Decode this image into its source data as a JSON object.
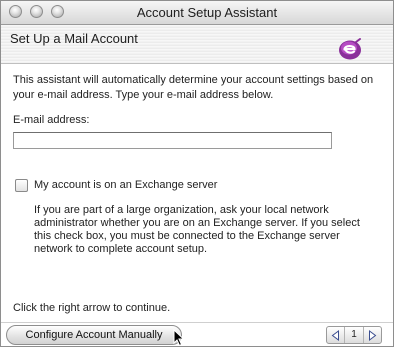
{
  "window": {
    "title": "Account Setup Assistant"
  },
  "header": {
    "title": "Set Up a Mail Account"
  },
  "main": {
    "intro": "This assistant will automatically determine your account settings based on your e-mail address. Type your e-mail address below.",
    "email_label": "E-mail address:",
    "email_value": "",
    "exchange_checkbox": {
      "label": "My account is on an Exchange server",
      "checked": false,
      "help": "If you are part of a large organization, ask your local network administrator whether you are on an Exchange server. If you select this check box, you must be connected to the Exchange server network to complete account setup."
    },
    "footer_text": "Click the right arrow to continue."
  },
  "bottom_bar": {
    "configure_button_label": "Configure Account Manually",
    "page_number": "1"
  },
  "colors": {
    "logo_purple": "#8a2f9a",
    "window_border": "#8e8e8e"
  },
  "icons": {
    "logo": "entourage-e-logo",
    "prev": "triangle-left-icon",
    "next": "triangle-right-icon",
    "cursor": "mouse-pointer-icon"
  }
}
